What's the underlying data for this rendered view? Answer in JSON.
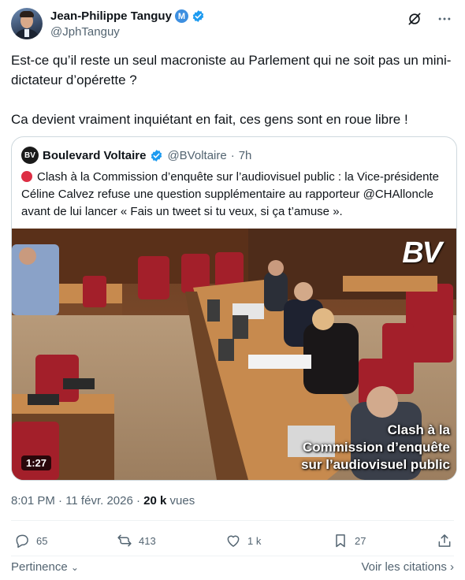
{
  "author": {
    "name": "Jean-Philippe Tanguy",
    "handle": "@JphTanguy",
    "affiliation_badge": "M"
  },
  "icons": {
    "verified": "verified-badge-icon",
    "grok": "grok-icon",
    "more": "more-icon",
    "reply": "reply-icon",
    "retweet": "retweet-icon",
    "like": "heart-icon",
    "bookmark": "bookmark-icon",
    "share": "share-icon"
  },
  "tweet": {
    "paragraph1": "Est-ce qu’il reste un seul macroniste au Parlement qui ne soit pas un mini-dictateur d’opérette ?",
    "paragraph2": "Ca devient vraiment inquiétant en fait, ces gens sont en roue libre !"
  },
  "quote": {
    "avatar_text": "BV",
    "name": "Boulevard Voltaire",
    "handle": "@BVoltaire",
    "separator": "·",
    "time": "7h",
    "text": "Clash à la Commission d’enquête sur l’audiovisuel public : la Vice-présidente Céline Calvez refuse une question supplémentaire au rapporteur @CHAlloncle avant de lui lancer « Fais un tweet si tu veux, si ça t’amuse ».",
    "video": {
      "duration": "1:27",
      "logo": "BV",
      "overlay_line1": "Clash à la",
      "overlay_line2": "Commission d’enquête",
      "overlay_line3": "sur l’audiovisuel public"
    }
  },
  "meta": {
    "time": "8:01 PM · 11 févr. 2026 · ",
    "views_count": "20 k",
    "views_label": " vues"
  },
  "stats": {
    "replies": "65",
    "retweets": "413",
    "likes": "1 k",
    "bookmarks": "27"
  },
  "footer": {
    "relevance": "Pertinence",
    "quotes_link": "Voir les citations"
  },
  "colors": {
    "text": "#0f1419",
    "secondary": "#536471",
    "verified_blue": "#1d9bf0",
    "border": "#cfd9de",
    "red_dot": "#dd2e44"
  }
}
